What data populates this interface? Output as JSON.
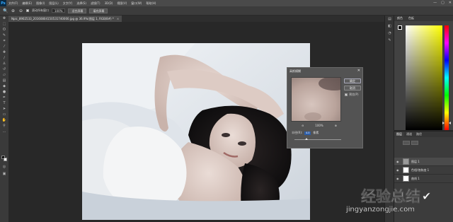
{
  "app": {
    "logo": "Ps"
  },
  "menu": [
    "文件(F)",
    "编辑(E)",
    "图像(I)",
    "图层(L)",
    "文字(Y)",
    "选择(S)",
    "滤镜(T)",
    "3D(D)",
    "视图(V)",
    "窗口(W)",
    "帮助(H)"
  ],
  "window_controls": {
    "minimize": "—",
    "maximize": "▢",
    "close": "✕"
  },
  "options": {
    "scroll_all_label": "滚动所有窗口",
    "zoom_value": "100%",
    "fit_screen": "适合屏幕",
    "fill_screen": "填充屏幕"
  },
  "document": {
    "tab_title": "Npic_8902533_20160804150531740000.jpg @ 36.9%(图层 1, RGB/8#) *",
    "tab_close": "×"
  },
  "dialog": {
    "title": "高斯模糊",
    "close": "✕",
    "ok": "确定",
    "cancel": "取消",
    "preview_label": "预览(P)",
    "preview_checked": true,
    "zoom_out": "⊖",
    "zoom_in": "⊕",
    "zoom_value": "100%",
    "radius_label": "半径(R):",
    "radius_value": "4.0",
    "radius_unit": "像素",
    "radius_fraction": 0.25
  },
  "color_panel": {
    "tabs": [
      "颜色",
      "色板"
    ],
    "hue_color": "#ffff00",
    "foreground": "#000000",
    "background": "#ffffff"
  },
  "layers_panel": {
    "tabs": [
      "图层",
      "通道",
      "路径"
    ],
    "layers": [
      {
        "name": "图层 1",
        "thumb": "photo"
      },
      {
        "name": "色相/饱和度 1",
        "thumb": "white"
      },
      {
        "name": "曲线 1",
        "thumb": "white"
      }
    ]
  },
  "watermark": {
    "title": "经验总结",
    "url": "jingyanzongjie.com"
  }
}
